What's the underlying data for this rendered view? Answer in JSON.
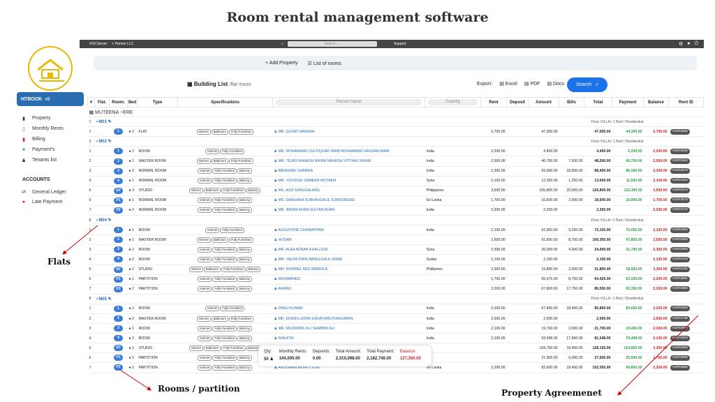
{
  "title": "Room rental management software",
  "topbar": {
    "server": "#V8 Server: ",
    "company": "< Homes LLC",
    "search_placeholder": "Search.....",
    "support": "Support"
  },
  "brand": {
    "name": "HTBOOK",
    "version": "v8"
  },
  "nav": [
    "Property",
    "Monthly Rents",
    "Billing",
    "Payment's",
    "Tenants list"
  ],
  "accounts": {
    "title": "ACCOUNTS",
    "items": [
      "General Ledger",
      "Late Payment"
    ]
  },
  "toolbar": {
    "add": "+ Add Property",
    "list": "List of rooms"
  },
  "page": {
    "title": "Building List",
    "path": "/flat /room",
    "export": "Export:",
    "excel": "Excel",
    "pdf": "PDF",
    "docs": "Docs",
    "search": "Search"
  },
  "headers": [
    "#",
    "Flat.",
    "Room.",
    "Bed",
    "Type",
    "Specifications",
    "Person name",
    "Country",
    "Rent",
    "Deposit",
    "Amount",
    "Bills",
    "Total",
    "Payment",
    "Balance",
    "Rent ID"
  ],
  "building": "MUTEENA",
  "building_sub": "~ERE",
  "rows": [
    {
      "k": "flat",
      "n": "1",
      "flat": "M01",
      "floor": "Floor VILLA / 1 Bed / Residential"
    },
    {
      "k": "r",
      "n": "1",
      "room": "1",
      "bed": "2",
      "type": "FLAT",
      "tags": [
        "Internet",
        "Bathroom",
        "Fully Furnished"
      ],
      "name": "MR. QUSAY HAMZAH",
      "country": "",
      "rent": "2,700.00",
      "dep": "",
      "amt": "47,000.00",
      "bills": "",
      "total": "47,000.00",
      "pay": "44,300.00",
      "bal": "2,700.00",
      "id": "AGR/3655"
    },
    {
      "k": "flat",
      "n": "2",
      "flat": "M02",
      "floor": "Floor VILLA / 1 Bed / Residential"
    },
    {
      "k": "r",
      "n": "1",
      "room": "1",
      "bed": "2",
      "type": "ROOM",
      "tags": [
        "Internet",
        "Fully Furnished"
      ],
      "name": "MR. MOHAMMAD ZULFIQUAR IMAM MOHAMMAD HASSAN IMAM",
      "country": "India",
      "rent": "2,200.00",
      "dep": "",
      "amt": "4,400.00",
      "bills": "",
      "total": "4,400.00",
      "pay": "2,200.00",
      "bal": "2,200.00",
      "id": "AGR/4602"
    },
    {
      "k": "r",
      "n": "2",
      "room": "2",
      "bed": "1",
      "type": "MASTER ROOM",
      "tags": [
        "Internet",
        "Bathroom",
        "Fully Furnished"
      ],
      "name": "MR. TEJAS MAHESH NIKAM MAHESH VITTHAL NIKAM",
      "country": "India",
      "rent": "2,500.00",
      "dep": "",
      "amt": "40,700.00",
      "bills": "7,500.00",
      "total": "48,200.00",
      "pay": "45,700.00",
      "bal": "2,500.00",
      "id": "AGR/3604"
    },
    {
      "k": "r",
      "n": "3",
      "room": "3",
      "bed": "2",
      "type": "NORMAL ROOM",
      "tags": [
        "Internet",
        "Fully Furnished",
        "Balcony"
      ],
      "name": "ABHISHEK SHARMA",
      "country": "India",
      "rent": "2,300.00",
      "dep": "",
      "amt": "69,900.00",
      "bills": "18,500.00",
      "total": "88,400.00",
      "pay": "86,100.00",
      "bal": "2,300.00",
      "id": "AGR/2679"
    },
    {
      "k": "r",
      "n": "4",
      "room": "4",
      "bed": "1",
      "type": "NORMAL ROOM",
      "tags": [
        "Internet",
        "Fully Furnished",
        "Balcony"
      ],
      "name": "MR. YOUSSEF SAMEER MOTAEM",
      "country": "Syria",
      "rent": "2,100.00",
      "dep": "",
      "amt": "12,350.00",
      "bills": "1,250.00",
      "total": "13,600.00",
      "pay": "11,500.00",
      "bal": "2,100.00",
      "id": "AGR/4118"
    },
    {
      "k": "r",
      "n": "5",
      "room": "GF",
      "bed": "3",
      "type": "STUDIO",
      "tags": [
        "Internet",
        "Bathroom",
        "Fully Furnished",
        "Balcony"
      ],
      "name": "MS. AIZA SANGGALANG",
      "country": "Philippines",
      "rent": "3,500.00",
      "dep": "",
      "amt": "105,800.00",
      "bills": "20,000.00",
      "total": "125,800.00",
      "pay": "122,300.00",
      "bal": "3,500.00",
      "id": "AGR/3014"
    },
    {
      "k": "r",
      "n": "6",
      "room": "P1",
      "bed": "1",
      "type": "NORMAL ROOM",
      "tags": [
        "Internet",
        "Fully Furnished",
        "Balcony"
      ],
      "name": "MS. SHASHIKA SUBHASGALIL SUBASINGHE",
      "country": "Sri Lanka",
      "rent": "1,700.00",
      "dep": "",
      "amt": "16,600.00",
      "bills": "2,000.00",
      "total": "18,600.00",
      "pay": "16,900.00",
      "bal": "1,700.00",
      "id": "AGR/3976"
    },
    {
      "k": "r",
      "n": "7",
      "room": "P2",
      "bed": "2",
      "type": "NORMAL ROOM",
      "tags": [
        "Internet",
        "Fully Furnished",
        "Balcony"
      ],
      "name": "MR. IMRAN KHAN SULTAN KHAN",
      "country": "India",
      "rent": "2,200.00",
      "dep": "",
      "amt": "2,200.00",
      "bills": "",
      "total": "2,200.00",
      "pay": "",
      "bal": "2,200.00",
      "id": "AGR/4744"
    },
    {
      "k": "flat",
      "n": "8",
      "flat": "M04",
      "floor": "Floor VILLA / 1 Bed / Residential"
    },
    {
      "k": "r",
      "n": "1",
      "room": "1",
      "bed": "1",
      "type": "ROOM",
      "tags": [
        "Internet",
        "Fully Furnished"
      ],
      "name": "AUGUSTINE CHINNAPPAN",
      "country": "India",
      "rent": "2,100.00",
      "dep": "",
      "amt": "62,900.00",
      "bills": "9,250.00",
      "total": "72,150.00",
      "pay": "70,050.00",
      "bal": "2,100.00",
      "id": "AGR/2680"
    },
    {
      "k": "r",
      "n": "2",
      "room": "2",
      "bed": "1",
      "type": "MASTER ROOM",
      "tags": [
        "Internet",
        "Bathroom",
        "Fully Furnished"
      ],
      "name": "HOSAM",
      "country": "",
      "rent": "2,500.00",
      "dep": "",
      "amt": "91,600.00",
      "bills": "8,750.00",
      "total": "100,350.00",
      "pay": "97,850.00",
      "bal": "2,500.00",
      "id": "AGR/2683"
    },
    {
      "k": "r",
      "n": "3",
      "room": "3",
      "bed": "2",
      "type": "ROOM",
      "tags": [
        "Internet",
        "Fully Furnished",
        "Balcony"
      ],
      "name": "MR. ALAA ADNAN KHALLOUF",
      "country": "Syria",
      "rent": "2,300.00",
      "dep": "",
      "amt": "20,000.00",
      "bills": "4,000.00",
      "total": "24,000.00",
      "pay": "21,700.00",
      "bal": "2,300.00",
      "id": "AGR/3963"
    },
    {
      "k": "r",
      "n": "4",
      "room": "4",
      "bed": "2",
      "type": "ROOM",
      "tags": [
        "Internet",
        "Fully Furnished",
        "Balcony"
      ],
      "name": "MR. YAHYA IDRIS ABDELGALIL ADAM",
      "country": "Sudan",
      "rent": "2,100.00",
      "dep": "",
      "amt": "2,100.00",
      "bills": "",
      "total": "2,100.00",
      "pay": "",
      "bal": "2,100.00",
      "id": "AGR/4715"
    },
    {
      "k": "r",
      "n": "5",
      "room": "GF",
      "bed": "2",
      "type": "STUDIO",
      "tags": [
        "Internet",
        "Bathroom",
        "Fully Furnished",
        "Balcony"
      ],
      "name": "MR. ROMMEL RED AMERICA",
      "country": "Phillipines",
      "rent": "3,300.00",
      "dep": "",
      "amt": "19,800.00",
      "bills": "2,000.00",
      "total": "21,800.00",
      "pay": "18,500.00",
      "bal": "3,300.00",
      "id": "AGR/4161"
    },
    {
      "k": "r",
      "n": "6",
      "room": "P1",
      "bed": "1",
      "type": "PARTITION",
      "tags": [
        "Internet",
        "Fully Furnished",
        "Balcony"
      ],
      "name": "MOHAMMED",
      "country": "",
      "rent": "1,700.00",
      "dep": "",
      "amt": "55,675.00",
      "bills": "8,750.00",
      "total": "64,425.00",
      "pay": "62,225.00",
      "bal": "2,200.00",
      "id": "AGR/2681"
    },
    {
      "k": "r",
      "n": "7",
      "room": "P2",
      "bed": "2",
      "type": "PARTITION",
      "tags": [
        "Internet",
        "Fully Furnished",
        "Balcony"
      ],
      "name": "AHMAD",
      "country": "",
      "rent": "2,200.00",
      "dep": "",
      "amt": "67,800.00",
      "bills": "17,750.00",
      "total": "85,550.00",
      "pay": "83,350.00",
      "bal": "2,200.00",
      "id": "AGR/2682"
    },
    {
      "k": "flat",
      "n": "8",
      "flat": "M05",
      "floor": "Floor VILLA / 1 Bed / Residential"
    },
    {
      "k": "r",
      "n": "1",
      "room": "1",
      "bed": "2",
      "type": "ROOM",
      "tags": [
        "Internet",
        "Fully Furnished"
      ],
      "name": "DINAJ KUMAR",
      "country": "India",
      "rent": "2,200.00",
      "dep": "",
      "amt": "67,400.00",
      "bills": "18,450.00",
      "total": "85,850.00",
      "pay": "83,650.00",
      "bal": "2,200.00",
      "id": "AGR/2684"
    },
    {
      "k": "r",
      "n": "2",
      "room": "2",
      "bed": "2",
      "type": "MASTER ROOM",
      "tags": [
        "Internet",
        "Bathroom",
        "Fully Furnished"
      ],
      "name": "MR. EDWIN LAZAR EADATHIRUTHIKKARAN",
      "country": "India",
      "rent": "2,500.00",
      "dep": "",
      "amt": "2,500.00",
      "bills": "",
      "total": "2,500.00",
      "pay": "",
      "bal": "2,500.00",
      "id": "AGR/4738"
    },
    {
      "k": "r",
      "n": "3",
      "room": "3",
      "bed": "1",
      "type": "ROOM",
      "tags": [
        "Internet",
        "Fully Furnished",
        "Balcony"
      ],
      "name": "MR. MUZAMMIL ALI SHABBIR ALI",
      "country": "India",
      "rent": "2,100.00",
      "dep": "",
      "amt": "19,700.00",
      "bills": "2,000.00",
      "total": "21,700.00",
      "pay": "19,400.00",
      "bal": "2,300.00",
      "id": "AGR/3967"
    },
    {
      "k": "r",
      "n": "4",
      "room": "4",
      "bed": "2",
      "type": "ROOM",
      "tags": [
        "Internet",
        "Fully Furnished",
        "Balcony"
      ],
      "name": "RANJITH",
      "country": "India",
      "rent": "2,100.00",
      "dep": "",
      "amt": "63,598.00",
      "bills": "17,950.00",
      "total": "81,548.00",
      "pay": "79,448.00",
      "bal": "2,100.00",
      "id": "AGR/2943"
    },
    {
      "k": "r",
      "n": "5",
      "room": "GF",
      "bed": "2",
      "type": "STUDIO",
      "tags": [
        "Internet",
        "Bathroom",
        "Fully Furnished",
        "Balcony"
      ],
      "name": "",
      "country": "",
      "rent": "",
      "dep": "",
      "amt": "109,700.00",
      "bills": "18,450.00",
      "total": "128,150.00",
      "pay": "124,850.00",
      "bal": "3,300.00",
      "id": "AGR/2686"
    },
    {
      "k": "r",
      "n": "6",
      "room": "P1",
      "bed": "2",
      "type": "PARTITION",
      "tags": [
        "Internet",
        "Fully Furnished",
        "Balcony"
      ],
      "name": "",
      "country": "",
      "rent": "",
      "dep": "",
      "amt": "21,600.00",
      "bills": "6,000.00",
      "total": "27,600.00",
      "pay": "25,900.00",
      "bal": "1,700.00",
      "id": "AGR/3808"
    },
    {
      "k": "r",
      "n": "7",
      "room": "P2",
      "bed": "2",
      "type": "PARTITION",
      "tags": [
        "Internet",
        "Fully Furnished",
        "Balcony"
      ],
      "name": "ANUSHANI MOHOTTIGE",
      "country": "Sri Lanka",
      "rent": "2,200.00",
      "dep": "",
      "amt": "83,600.00",
      "bills": "18,450.00",
      "total": "102,050.00",
      "pay": "99,850.00",
      "bal": "2,200.00",
      "id": "AGR/2685"
    }
  ],
  "summary": {
    "qty_label": "Qty:",
    "qty": "50",
    "mr_label": "Monthly Rents:",
    "mr": "104,000.00",
    "dep_label": "Deposits:",
    "dep": "0.00",
    "ta_label": "Total Amount:",
    "ta": "2,310,098.00",
    "tp_label": "Total Payment:",
    "tp": "2,182,748.00",
    "bal_label": "Balance:",
    "bal": "127,350.00"
  },
  "annotations": {
    "flats": "Flats",
    "rooms": "Rooms / partition",
    "agreement": "Property Agreemenet"
  },
  "colors": {
    "accent": "#1a73e8",
    "green": "#2e9b4a",
    "red": "#cc2222"
  }
}
